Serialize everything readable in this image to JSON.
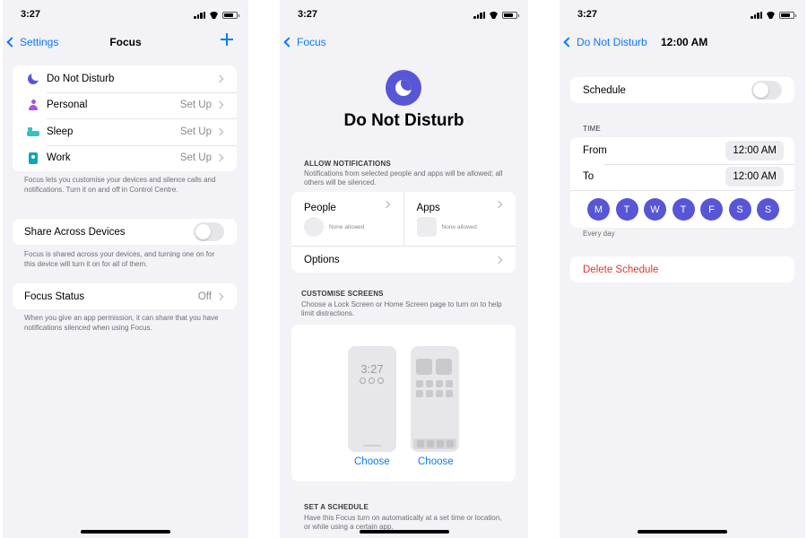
{
  "status_time": "3:27",
  "screen1": {
    "back_label": "Settings",
    "title": "Focus",
    "focus_modes": [
      {
        "icon": "moon-icon",
        "label": "Do Not Disturb",
        "value": ""
      },
      {
        "icon": "person-icon",
        "label": "Personal",
        "value": "Set Up"
      },
      {
        "icon": "bed-icon",
        "label": "Sleep",
        "value": "Set Up"
      },
      {
        "icon": "work-badge-icon",
        "label": "Work",
        "value": "Set Up"
      }
    ],
    "modes_footer": "Focus lets you customise your devices and silence calls and notifications. Turn it on and off in Control Centre.",
    "share_label": "Share Across Devices",
    "share_on": false,
    "share_footer": "Focus is shared across your devices, and turning one on for this device will turn it on for all of them.",
    "focus_status_label": "Focus Status",
    "focus_status_value": "Off",
    "status_footer": "When you give an app permission, it can share that you have notifications silenced when using Focus."
  },
  "screen2": {
    "back_label": "Focus",
    "title": "Do Not Disturb",
    "allow_header": "ALLOW NOTIFICATIONS",
    "allow_sub": "Notifications from selected people and apps will be allowed; all others will be silenced.",
    "people_label": "People",
    "people_value": "None allowed",
    "apps_label": "Apps",
    "apps_value": "None allowed",
    "options_label": "Options",
    "customise_header": "CUSTOMISE SCREENS",
    "customise_sub": "Choose a Lock Screen or Home Screen page to turn on to help limit distractions.",
    "lock_preview_time": "3:27",
    "choose_lock": "Choose",
    "choose_home": "Choose",
    "schedule_header": "SET A SCHEDULE",
    "schedule_sub": "Have this Focus turn on automatically at a set time or location, or while using a certain app."
  },
  "screen3": {
    "back_label": "Do Not Disturb",
    "title": "12:00 AM",
    "schedule_label": "Schedule",
    "schedule_on": false,
    "time_header": "TIME",
    "from_label": "From",
    "from_value": "12:00 AM",
    "to_label": "To",
    "to_value": "12:00 AM",
    "days": [
      "M",
      "T",
      "W",
      "T",
      "F",
      "S",
      "S"
    ],
    "days_footer": "Every day",
    "delete_label": "Delete Schedule"
  },
  "colors": {
    "accent": "#0a7aff",
    "dnd_purple": "#5856d6",
    "destructive": "#e0352b",
    "background": "#f2f2f7"
  }
}
